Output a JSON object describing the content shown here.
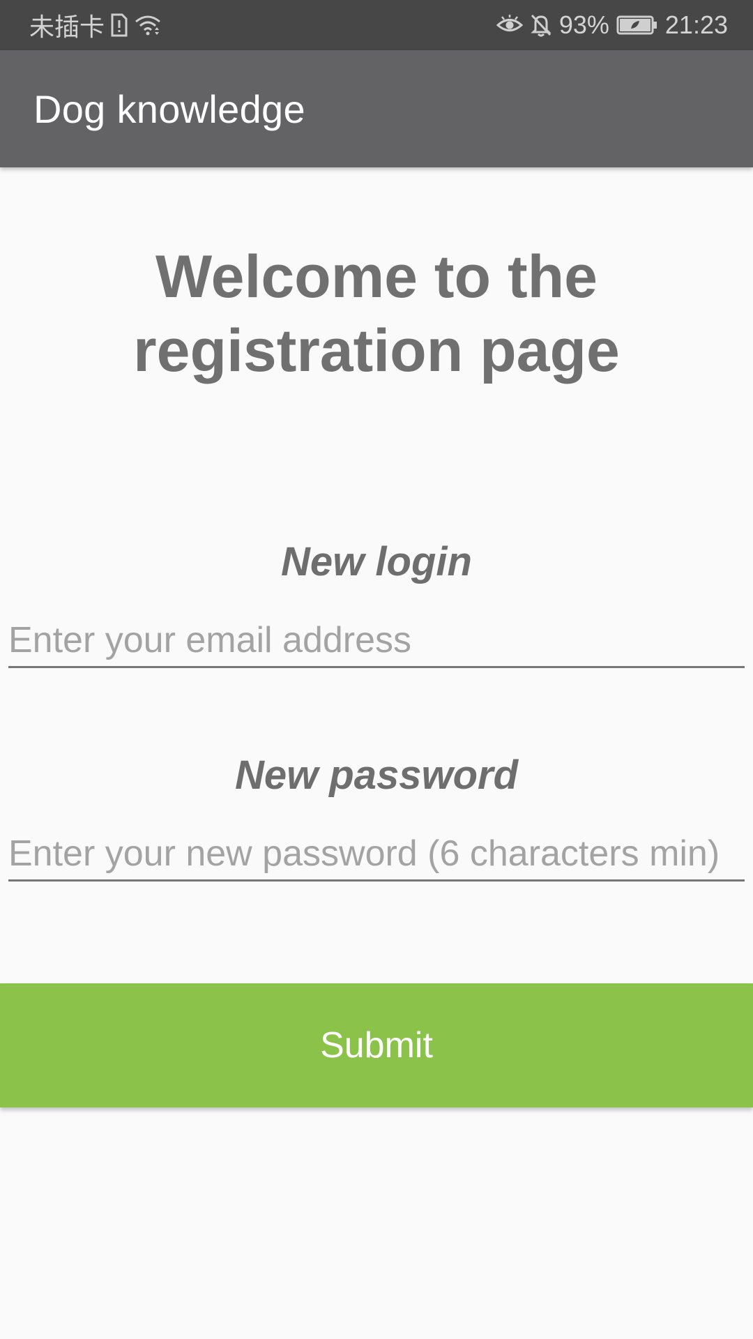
{
  "status_bar": {
    "carrier": "未插卡",
    "battery_percent": "93%",
    "time": "21:23",
    "icons": [
      "sim-alert-icon",
      "wifi-icon",
      "eye-icon",
      "bell-off-icon",
      "battery-icon"
    ]
  },
  "app_bar": {
    "title": "Dog knowledge"
  },
  "main": {
    "heading_line1": "Welcome to the",
    "heading_line2": "registration page",
    "login_label": "New login",
    "email_placeholder": "Enter your email address",
    "password_label": "New password",
    "password_placeholder": "Enter your new password (6 characters min)",
    "submit_label": "Submit"
  },
  "colors": {
    "status_bar_bg": "#474747",
    "app_bar_bg": "#636365",
    "submit_bg": "#8bc34a",
    "label_text": "#707070"
  }
}
